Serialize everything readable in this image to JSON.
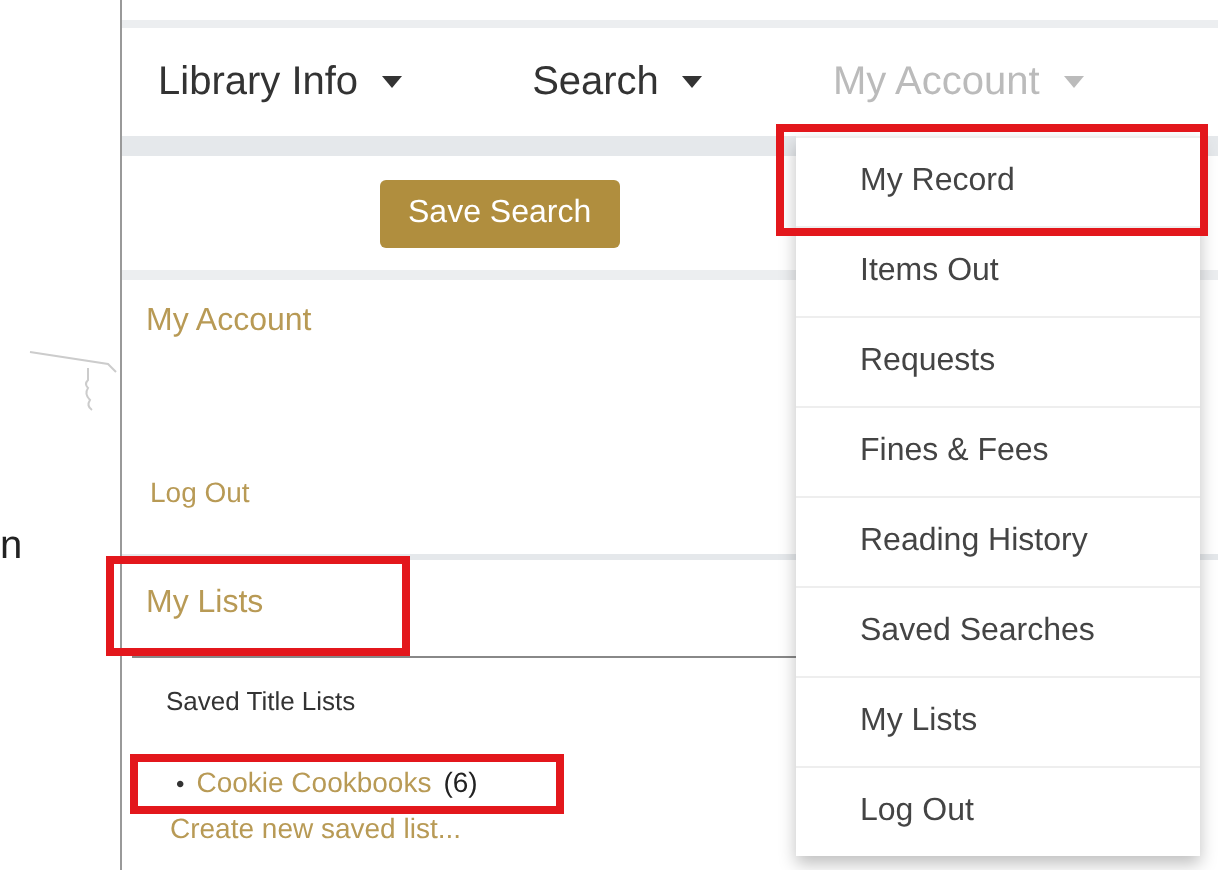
{
  "margin_text": "n",
  "nav": [
    {
      "label": "Library Info",
      "expanded": false
    },
    {
      "label": "Search",
      "expanded": false
    },
    {
      "label": "My Account",
      "expanded": true
    }
  ],
  "save_button": "Save Search",
  "account_panel": {
    "heading": "My Account",
    "links": [
      "Log Out"
    ]
  },
  "lists_panel": {
    "heading": "My Lists",
    "highlighted": true,
    "subheading": "Saved Title Lists",
    "lists": [
      {
        "marker": "•",
        "name": "Cookie Cookbooks",
        "count": "(6)",
        "highlighted": true
      }
    ],
    "create_link": "Create new saved list..."
  },
  "dropdown": [
    {
      "label": "My Record",
      "highlighted": true
    },
    {
      "label": "Items Out",
      "highlighted": false
    },
    {
      "label": "Requests",
      "highlighted": false
    },
    {
      "label": "Fines & Fees",
      "highlighted": false
    },
    {
      "label": "Reading History",
      "highlighted": false
    },
    {
      "label": "Saved Searches",
      "highlighted": false
    },
    {
      "label": "My Lists",
      "highlighted": false
    },
    {
      "label": "Log Out",
      "highlighted": false
    }
  ]
}
